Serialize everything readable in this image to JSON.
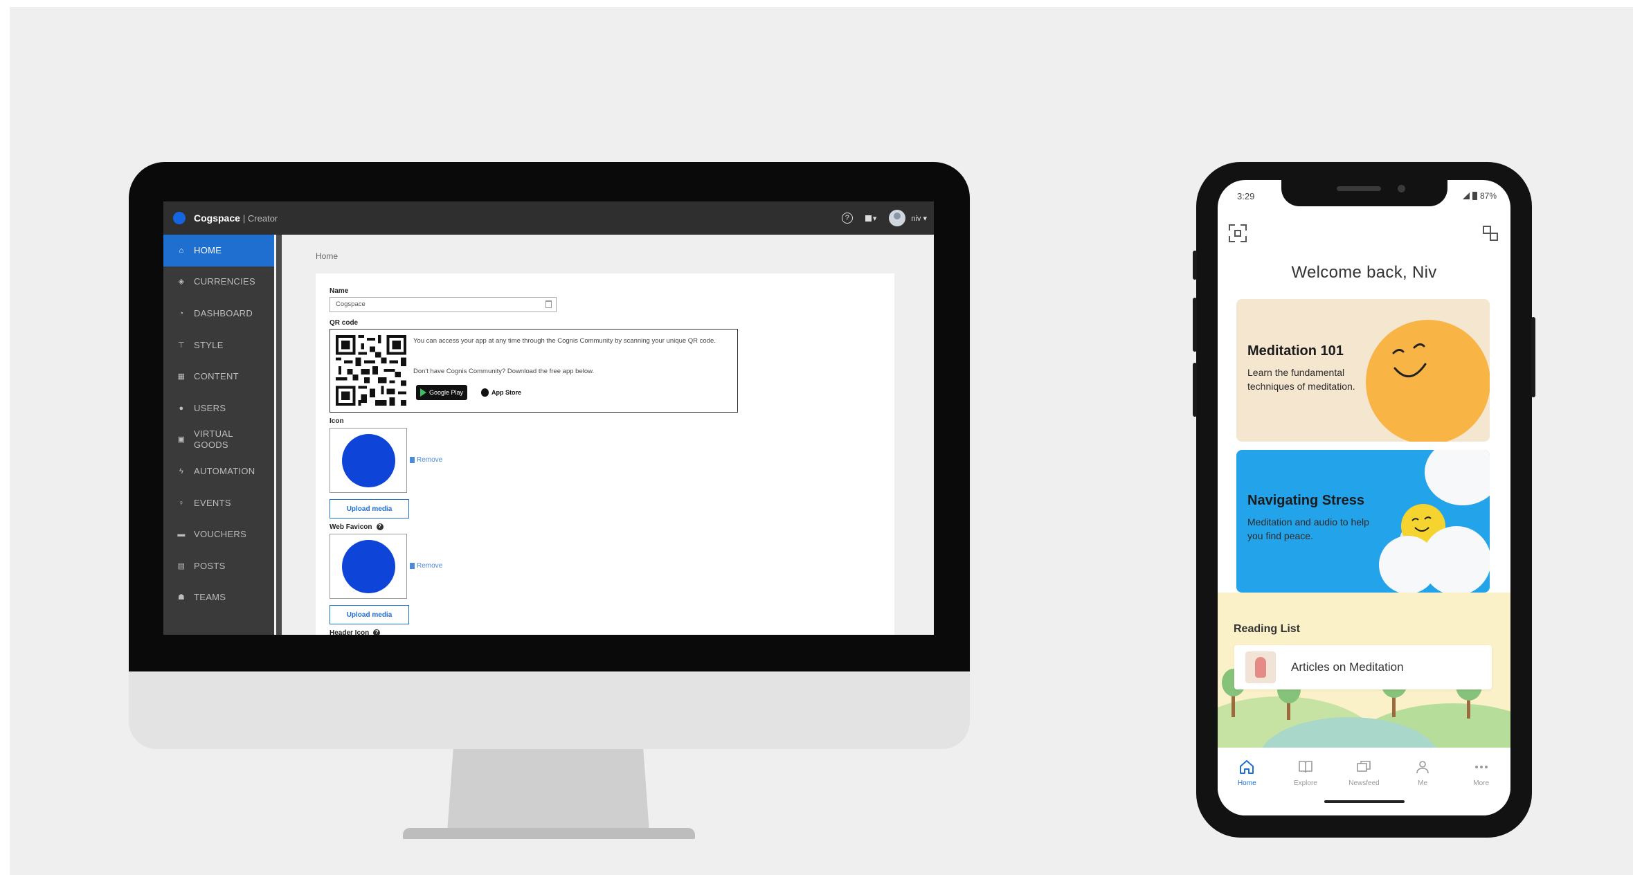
{
  "desktop": {
    "app": {
      "brand": "Cogspace",
      "brand_suffix": "| Creator",
      "help": "?",
      "user": "niv ▾"
    },
    "sidebar": {
      "items": [
        {
          "label": "HOME",
          "icon": "home-icon",
          "glyph": "⌂"
        },
        {
          "label": "CURRENCIES",
          "icon": "currency-icon",
          "glyph": "◈"
        },
        {
          "label": "DASHBOARD",
          "icon": "dashboard-icon",
          "glyph": "◔"
        },
        {
          "label": "STYLE",
          "icon": "paint-roller-icon",
          "glyph": "⊤"
        },
        {
          "label": "CONTENT",
          "icon": "content-grid-icon",
          "glyph": "▦"
        },
        {
          "label": "USERS",
          "icon": "user-icon",
          "glyph": "●"
        },
        {
          "label": "VIRTUAL GOODS",
          "icon": "gift-icon",
          "glyph": "▣"
        },
        {
          "label": "AUTOMATION",
          "icon": "bolt-icon",
          "glyph": "ϟ"
        },
        {
          "label": "EVENTS",
          "icon": "pin-icon",
          "glyph": "♀"
        },
        {
          "label": "VOUCHERS",
          "icon": "voucher-icon",
          "glyph": "▬"
        },
        {
          "label": "POSTS",
          "icon": "posts-icon",
          "glyph": "▤"
        },
        {
          "label": "TEAMS",
          "icon": "teams-icon",
          "glyph": "☗"
        }
      ]
    },
    "breadcrumb": "Home",
    "form": {
      "name_label": "Name",
      "name_value": "Cogspace",
      "qr_label": "QR code",
      "qr_text_1": "You can access your app at any time through the Cognis Community by scanning your unique QR code.",
      "qr_text_2": "Don't have Cognis Community? Download the free app below.",
      "google_play": "Google Play",
      "app_store": "App Store",
      "icon_label": "Icon",
      "remove": "Remove",
      "upload": "Upload media",
      "favicon_label": "Web Favicon",
      "header_icon_label": "Header Icon"
    },
    "colors": {
      "accent": "#1f6fd1",
      "sidebar": "#3a3a3a",
      "icon_blue": "#0e45d8"
    }
  },
  "phone": {
    "status": {
      "time": "3:29",
      "battery": "87%"
    },
    "welcome": "Welcome back, Niv",
    "cards": [
      {
        "title": "Meditation 101",
        "subtitle": "Learn the fundamental techniques of meditation."
      },
      {
        "title": "Navigating Stress",
        "subtitle": "Meditation and audio to help you find peace."
      }
    ],
    "reading_list": {
      "title": "Reading List",
      "items": [
        "Articles on Meditation"
      ]
    },
    "tabs": [
      {
        "label": "Home",
        "icon": "home-icon"
      },
      {
        "label": "Explore",
        "icon": "book-icon"
      },
      {
        "label": "Newsfeed",
        "icon": "newsfeed-icon"
      },
      {
        "label": "Me",
        "icon": "person-icon"
      },
      {
        "label": "More",
        "icon": "more-icon"
      }
    ]
  }
}
